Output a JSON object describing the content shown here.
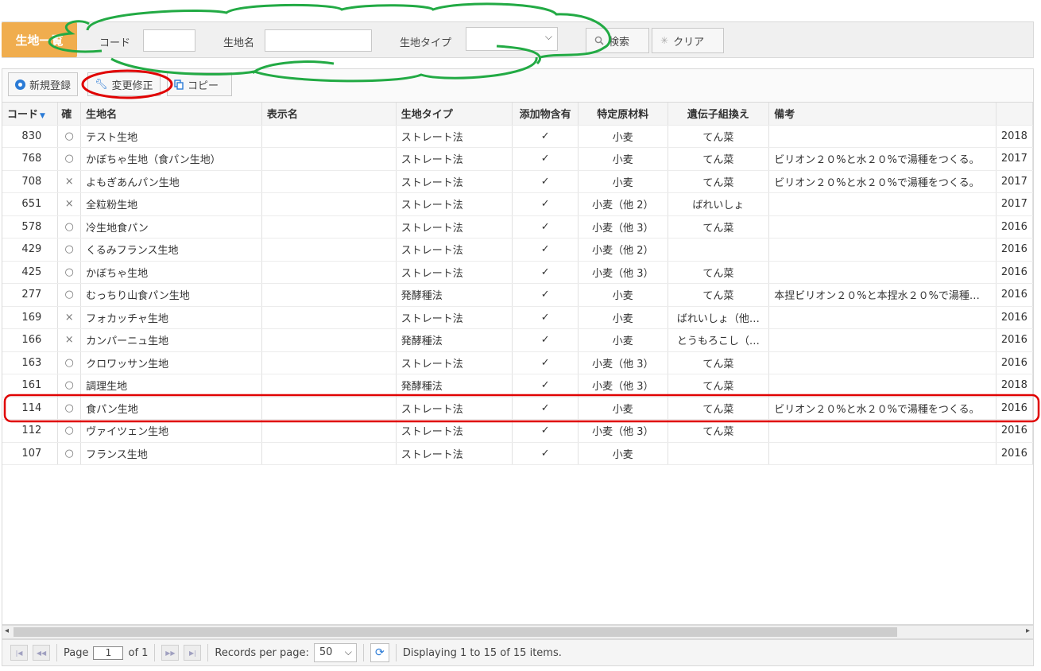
{
  "header": {
    "title": "生地一覧",
    "code_label": "コード",
    "code_value": "",
    "name_label": "生地名",
    "name_value": "",
    "type_label": "生地タイプ",
    "type_value": "",
    "search_label": "検索",
    "clear_label": "クリア"
  },
  "toolbar": {
    "new_label": "新規登録",
    "edit_label": "変更修正",
    "copy_label": "コピー"
  },
  "columns": [
    "コード",
    "確",
    "生地名",
    "表示名",
    "生地タイプ",
    "添加物含有",
    "特定原材料",
    "遺伝子組換え",
    "備考",
    ""
  ],
  "rows": [
    {
      "code": "830",
      "mark": "○",
      "name": "テスト生地",
      "display": "",
      "type": "ストレート法",
      "additive": "✓",
      "allergen": "小麦",
      "gmo": "てん菜",
      "note": "",
      "date": "2018"
    },
    {
      "code": "768",
      "mark": "○",
      "name": "かぼちゃ生地（食パン生地）",
      "display": "",
      "type": "ストレート法",
      "additive": "✓",
      "allergen": "小麦",
      "gmo": "てん菜",
      "note": "ビリオン２０%と水２０%で湯種をつくる。",
      "date": "2017"
    },
    {
      "code": "708",
      "mark": "×",
      "name": "よもぎあんパン生地",
      "display": "",
      "type": "ストレート法",
      "additive": "✓",
      "allergen": "小麦",
      "gmo": "てん菜",
      "note": "ビリオン２０%と水２０%で湯種をつくる。",
      "date": "2017"
    },
    {
      "code": "651",
      "mark": "×",
      "name": "全粒粉生地",
      "display": "",
      "type": "ストレート法",
      "additive": "✓",
      "allergen": "小麦（他 2）",
      "gmo": "ばれいしょ",
      "note": "",
      "date": "2017"
    },
    {
      "code": "578",
      "mark": "○",
      "name": "冷生地食パン",
      "display": "",
      "type": "ストレート法",
      "additive": "✓",
      "allergen": "小麦（他 3）",
      "gmo": "てん菜",
      "note": "",
      "date": "2016"
    },
    {
      "code": "429",
      "mark": "○",
      "name": "くるみフランス生地",
      "display": "",
      "type": "ストレート法",
      "additive": "✓",
      "allergen": "小麦（他 2）",
      "gmo": "",
      "note": "",
      "date": "2016"
    },
    {
      "code": "425",
      "mark": "○",
      "name": "かぼちゃ生地",
      "display": "",
      "type": "ストレート法",
      "additive": "✓",
      "allergen": "小麦（他 3）",
      "gmo": "てん菜",
      "note": "",
      "date": "2016"
    },
    {
      "code": "277",
      "mark": "○",
      "name": "むっちり山食パン生地",
      "display": "",
      "type": "発酵種法",
      "additive": "✓",
      "allergen": "小麦",
      "gmo": "てん菜",
      "note": "本捏ビリオン２０%と本捏水２０%で湯種…",
      "date": "2016"
    },
    {
      "code": "169",
      "mark": "×",
      "name": "フォカッチャ生地",
      "display": "",
      "type": "ストレート法",
      "additive": "✓",
      "allergen": "小麦",
      "gmo": "ばれいしょ（他…",
      "note": "",
      "date": "2016"
    },
    {
      "code": "166",
      "mark": "×",
      "name": "カンパーニュ生地",
      "display": "",
      "type": "発酵種法",
      "additive": "✓",
      "allergen": "小麦",
      "gmo": "とうもろこし（…",
      "note": "",
      "date": "2016"
    },
    {
      "code": "163",
      "mark": "○",
      "name": "クロワッサン生地",
      "display": "",
      "type": "ストレート法",
      "additive": "✓",
      "allergen": "小麦（他 3）",
      "gmo": "てん菜",
      "note": "",
      "date": "2016"
    },
    {
      "code": "161",
      "mark": "○",
      "name": "調理生地",
      "display": "",
      "type": "発酵種法",
      "additive": "✓",
      "allergen": "小麦（他 3）",
      "gmo": "てん菜",
      "note": "",
      "date": "2018"
    },
    {
      "code": "114",
      "mark": "○",
      "name": "食パン生地",
      "display": "",
      "type": "ストレート法",
      "additive": "✓",
      "allergen": "小麦",
      "gmo": "てん菜",
      "note": "ビリオン２０%と水２０%で湯種をつくる。",
      "date": "2016"
    },
    {
      "code": "112",
      "mark": "○",
      "name": "ヴァイツェン生地",
      "display": "",
      "type": "ストレート法",
      "additive": "✓",
      "allergen": "小麦（他 3）",
      "gmo": "てん菜",
      "note": "",
      "date": "2016"
    },
    {
      "code": "107",
      "mark": "○",
      "name": "フランス生地",
      "display": "",
      "type": "ストレート法",
      "additive": "✓",
      "allergen": "小麦",
      "gmo": "",
      "note": "",
      "date": "2016"
    }
  ],
  "pager": {
    "page_label": "Page",
    "page_value": "1",
    "of_label": "of 1",
    "rpp_label": "Records per page:",
    "rpp_value": "50",
    "status": "Displaying 1 to 15 of 15 items."
  },
  "colors": {
    "title_bg": "#f0ad4e",
    "accent_blue": "#2b7bd6",
    "annotation_green": "#22aa44",
    "annotation_red": "#e00000"
  }
}
